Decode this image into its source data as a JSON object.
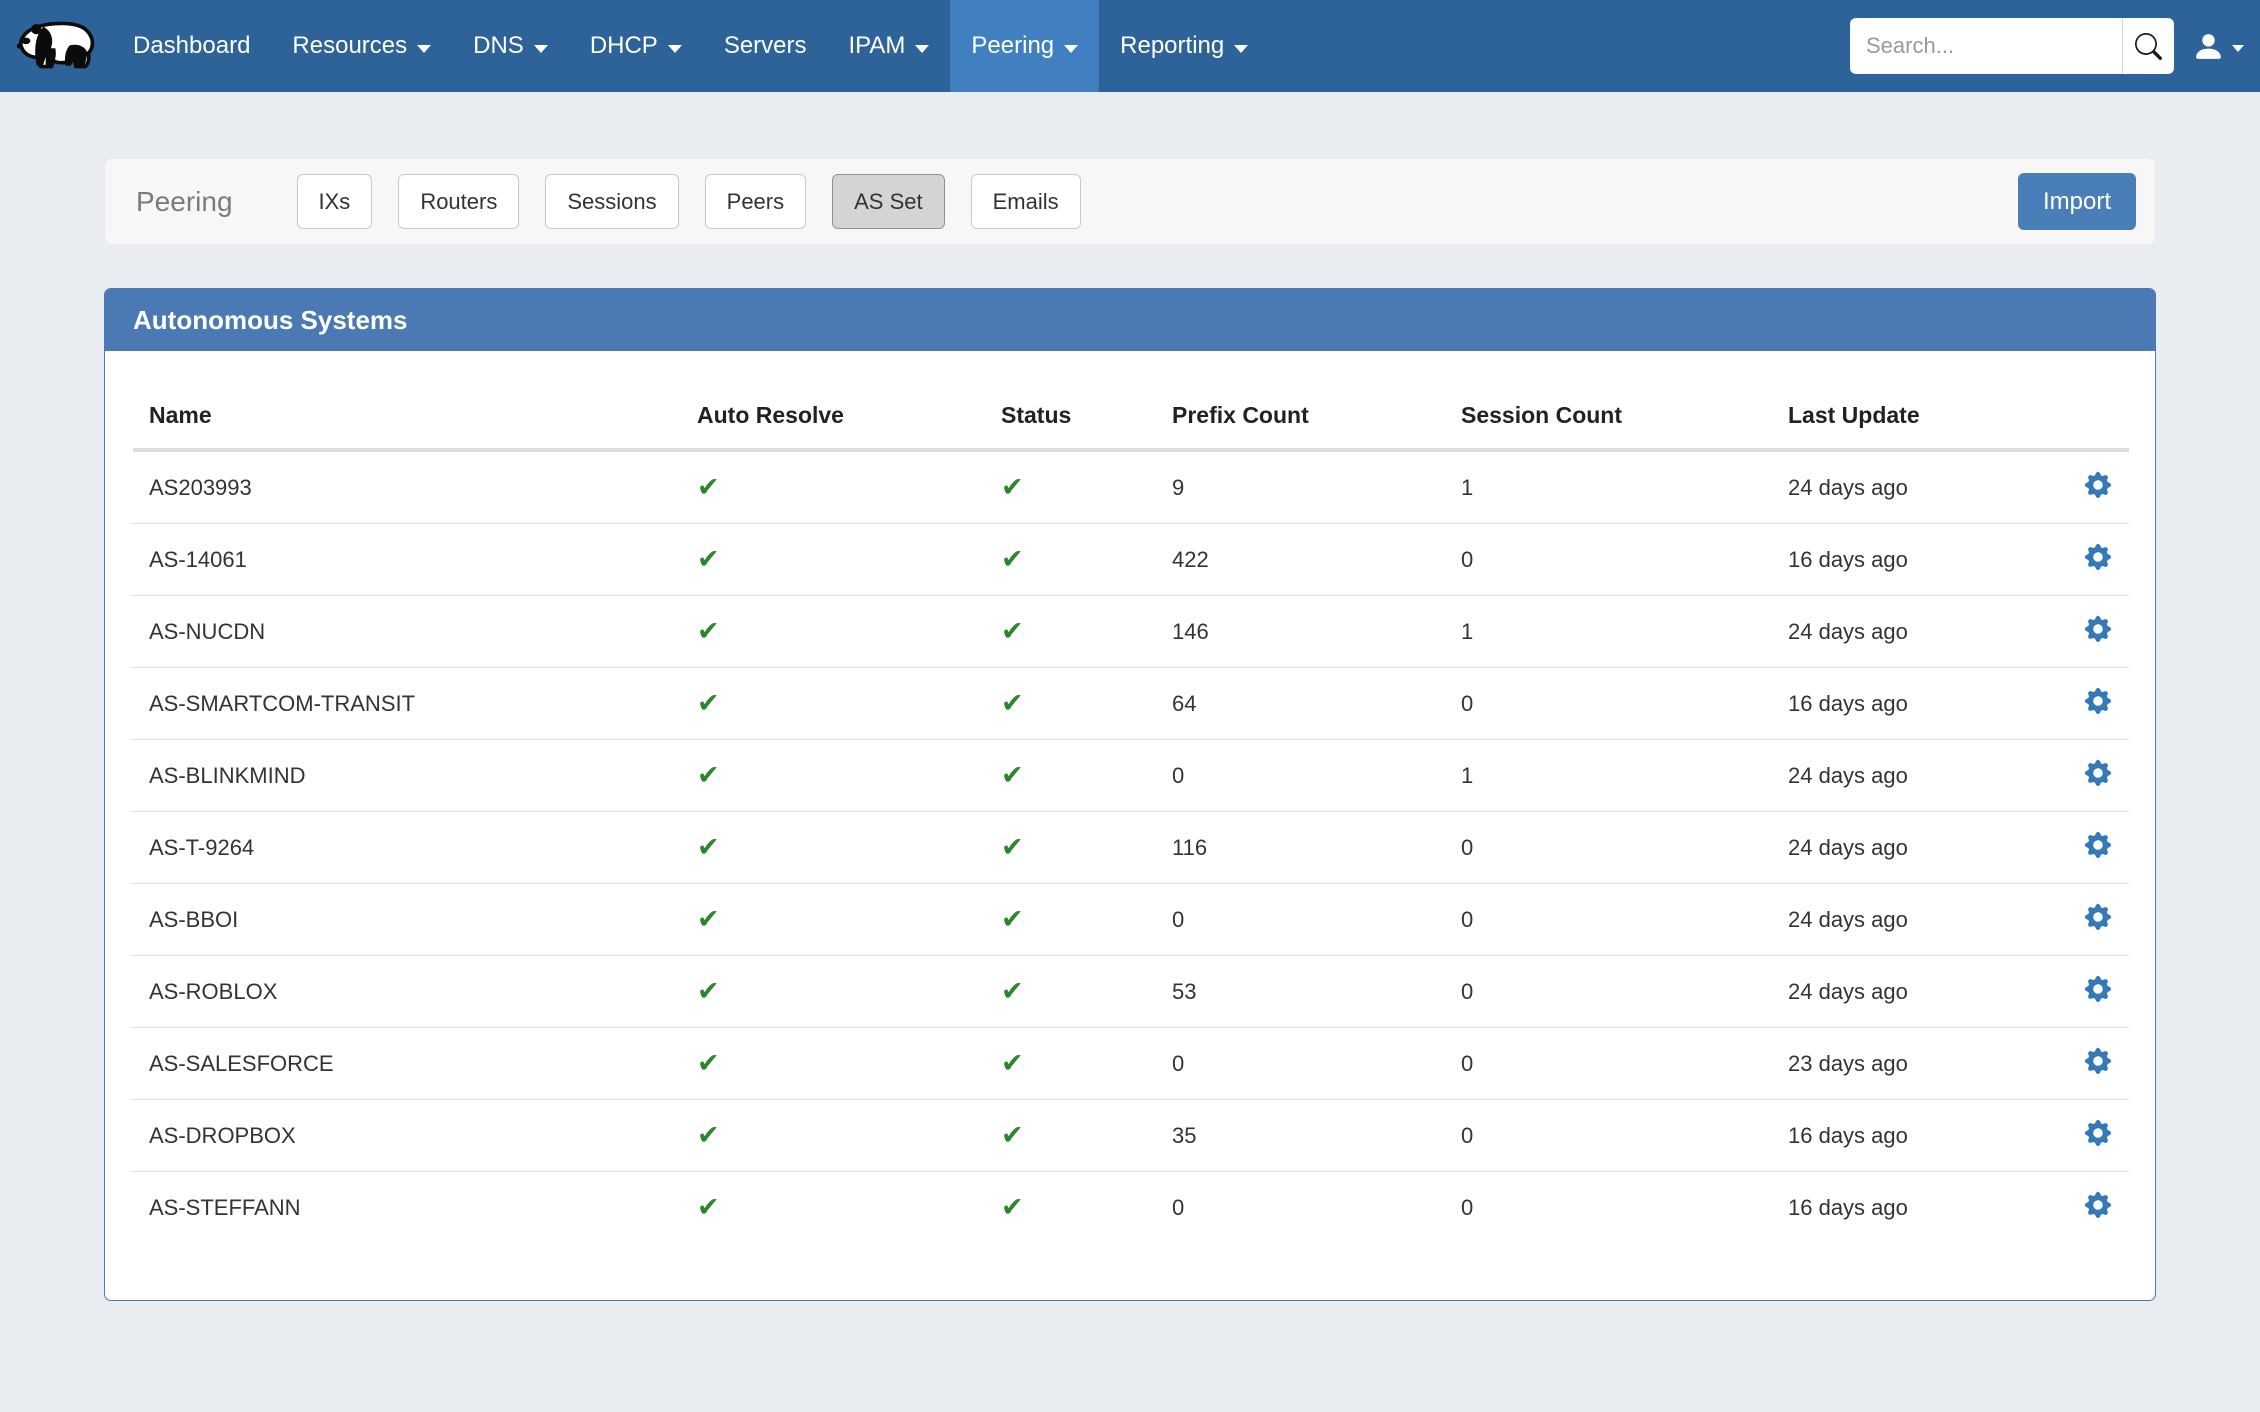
{
  "nav": {
    "logo": "badger-logo",
    "items": [
      {
        "label": "Dashboard",
        "dropdown": false,
        "active": false
      },
      {
        "label": "Resources",
        "dropdown": true,
        "active": false
      },
      {
        "label": "DNS",
        "dropdown": true,
        "active": false
      },
      {
        "label": "DHCP",
        "dropdown": true,
        "active": false
      },
      {
        "label": "Servers",
        "dropdown": false,
        "active": false
      },
      {
        "label": "IPAM",
        "dropdown": true,
        "active": false
      },
      {
        "label": "Peering",
        "dropdown": true,
        "active": true
      },
      {
        "label": "Reporting",
        "dropdown": true,
        "active": false
      }
    ],
    "search": {
      "placeholder": "Search..."
    }
  },
  "toolbar": {
    "title": "Peering",
    "tabs": [
      {
        "label": "IXs",
        "active": false
      },
      {
        "label": "Routers",
        "active": false
      },
      {
        "label": "Sessions",
        "active": false
      },
      {
        "label": "Peers",
        "active": false
      },
      {
        "label": "AS Set",
        "active": true
      },
      {
        "label": "Emails",
        "active": false
      }
    ],
    "import_label": "Import"
  },
  "panel": {
    "title": "Autonomous Systems",
    "columns": [
      "Name",
      "Auto Resolve",
      "Status",
      "Prefix Count",
      "Session Count",
      "Last Update"
    ],
    "rows": [
      {
        "name": "AS203993",
        "auto_resolve": true,
        "status": true,
        "prefix_count": "9",
        "session_count": "1",
        "last_update": "24 days ago"
      },
      {
        "name": "AS-14061",
        "auto_resolve": true,
        "status": true,
        "prefix_count": "422",
        "session_count": "0",
        "last_update": "16 days ago"
      },
      {
        "name": "AS-NUCDN",
        "auto_resolve": true,
        "status": true,
        "prefix_count": "146",
        "session_count": "1",
        "last_update": "24 days ago"
      },
      {
        "name": "AS-SMARTCOM-TRANSIT",
        "auto_resolve": true,
        "status": true,
        "prefix_count": "64",
        "session_count": "0",
        "last_update": "16 days ago"
      },
      {
        "name": "AS-BLINKMIND",
        "auto_resolve": true,
        "status": true,
        "prefix_count": "0",
        "session_count": "1",
        "last_update": "24 days ago"
      },
      {
        "name": "AS-T-9264",
        "auto_resolve": true,
        "status": true,
        "prefix_count": "116",
        "session_count": "0",
        "last_update": "24 days ago"
      },
      {
        "name": "AS-BBOI",
        "auto_resolve": true,
        "status": true,
        "prefix_count": "0",
        "session_count": "0",
        "last_update": "24 days ago"
      },
      {
        "name": "AS-ROBLOX",
        "auto_resolve": true,
        "status": true,
        "prefix_count": "53",
        "session_count": "0",
        "last_update": "24 days ago"
      },
      {
        "name": "AS-SALESFORCE",
        "auto_resolve": true,
        "status": true,
        "prefix_count": "0",
        "session_count": "0",
        "last_update": "23 days ago"
      },
      {
        "name": "AS-DROPBOX",
        "auto_resolve": true,
        "status": true,
        "prefix_count": "35",
        "session_count": "0",
        "last_update": "16 days ago"
      },
      {
        "name": "AS-STEFFANN",
        "auto_resolve": true,
        "status": true,
        "prefix_count": "0",
        "session_count": "0",
        "last_update": "16 days ago"
      }
    ]
  },
  "icons": {
    "check_glyph": "✔",
    "check": "check-icon",
    "gear": "gear-icon",
    "search": "search-icon",
    "user": "user-icon",
    "caret": "caret-down-icon",
    "logo": "badger-logo"
  },
  "colors": {
    "navbar_bg": "#2d6399",
    "navbar_active_bg": "#4080c0",
    "panel_header_bg": "#4a79b4",
    "panel_border": "#4a79b4",
    "import_button_bg": "#4a7eb8",
    "active_tab_bg": "#d4d4d4",
    "check_green": "#2d862d",
    "gear_blue": "#3579b8",
    "page_bg": "#e9edf2",
    "toolbar_bg": "#f7f7f7"
  }
}
